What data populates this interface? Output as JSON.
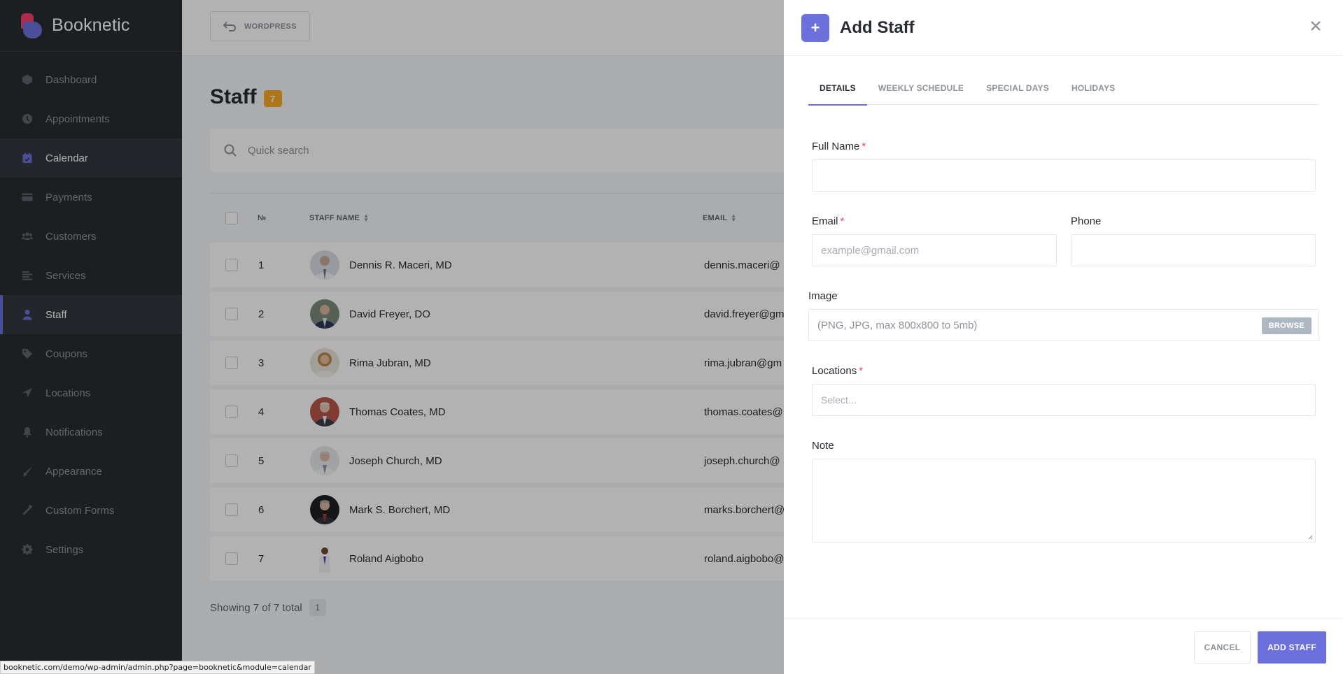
{
  "brand": {
    "name": "Booknetic"
  },
  "sidebar": {
    "items": [
      {
        "label": "Dashboard",
        "icon": "dashboard-icon"
      },
      {
        "label": "Appointments",
        "icon": "clock-icon"
      },
      {
        "label": "Calendar",
        "icon": "calendar-icon"
      },
      {
        "label": "Payments",
        "icon": "credit-card-icon"
      },
      {
        "label": "Customers",
        "icon": "users-icon"
      },
      {
        "label": "Services",
        "icon": "list-icon"
      },
      {
        "label": "Staff",
        "icon": "user-icon"
      },
      {
        "label": "Coupons",
        "icon": "tag-icon"
      },
      {
        "label": "Locations",
        "icon": "location-arrow-icon"
      },
      {
        "label": "Notifications",
        "icon": "bell-icon"
      },
      {
        "label": "Appearance",
        "icon": "brush-icon"
      },
      {
        "label": "Custom Forms",
        "icon": "magic-wand-icon"
      },
      {
        "label": "Settings",
        "icon": "gear-icon"
      }
    ],
    "active": "Staff",
    "hovered": "Calendar"
  },
  "topbar": {
    "wordpress_label": "WORDPRESS"
  },
  "page": {
    "title": "Staff",
    "count": "7",
    "search_placeholder": "Quick search",
    "footer_text": "Showing 7 of 7 total",
    "page_number": "1"
  },
  "table": {
    "columns": {
      "num": "№",
      "name": "STAFF NAME",
      "email": "EMAIL"
    },
    "rows": [
      {
        "num": "1",
        "name": "Dennis R. Maceri, MD",
        "email": "dennis.maceri@"
      },
      {
        "num": "2",
        "name": "David Freyer, DO",
        "email": "david.freyer@gm"
      },
      {
        "num": "3",
        "name": "Rima Jubran, MD",
        "email": "rima.jubran@gm"
      },
      {
        "num": "4",
        "name": "Thomas Coates, MD",
        "email": "thomas.coates@"
      },
      {
        "num": "5",
        "name": "Joseph Church, MD",
        "email": "joseph.church@"
      },
      {
        "num": "6",
        "name": "Mark S. Borchert, MD",
        "email": "marks.borchert@"
      },
      {
        "num": "7",
        "name": "Roland Aigbobo",
        "email": "roland.aigbobo@"
      }
    ]
  },
  "panel": {
    "title": "Add Staff",
    "tabs": [
      "DETAILS",
      "WEEKLY SCHEDULE",
      "SPECIAL DAYS",
      "HOLIDAYS"
    ],
    "active_tab": "DETAILS",
    "fields": {
      "full_name": {
        "label": "Full Name",
        "required": "*",
        "value": "",
        "placeholder": ""
      },
      "email": {
        "label": "Email",
        "required": "*",
        "value": "",
        "placeholder": "example@gmail.com"
      },
      "phone": {
        "label": "Phone",
        "value": "",
        "placeholder": ""
      },
      "image": {
        "label": "Image",
        "placeholder": "(PNG, JPG, max 800x800 to 5mb)",
        "browse_label": "BROWSE"
      },
      "locations": {
        "label": "Locations",
        "required": "*",
        "placeholder": "Select..."
      },
      "note": {
        "label": "Note",
        "value": ""
      }
    },
    "cancel_label": "CANCEL",
    "submit_label": "ADD STAFF"
  },
  "statusbar": {
    "url": "booknetic.com/demo/wp-admin/admin.php?page=booknetic&module=calendar"
  },
  "colors": {
    "accent": "#6c70dc",
    "brand_pink": "#fb3e6e",
    "badge": "#f9a825",
    "sidebar_bg": "#292d32"
  }
}
